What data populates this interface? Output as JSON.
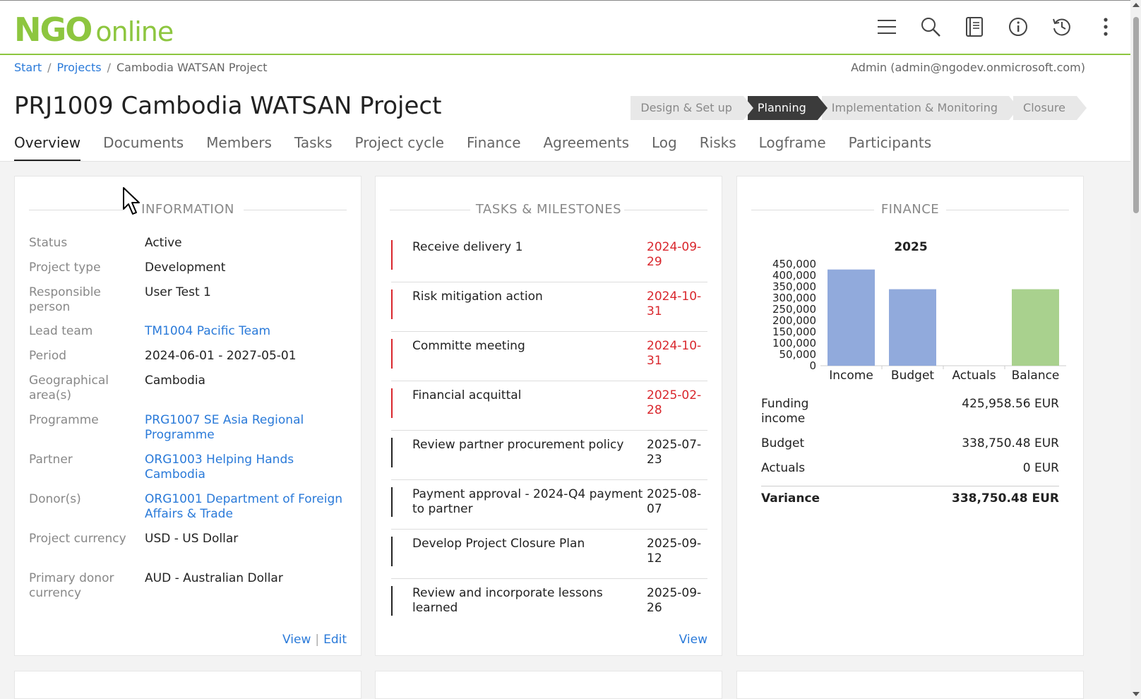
{
  "header": {
    "logo_ngo": "NGO",
    "logo_online": "online",
    "icons": [
      "menu-icon",
      "search-icon",
      "book-icon",
      "info-icon",
      "history-icon",
      "more-vertical-icon"
    ]
  },
  "breadcrumb": {
    "start": "Start",
    "sep1": "/",
    "projects": "Projects",
    "sep2": "/",
    "current": "Cambodia WATSAN Project"
  },
  "user": "Admin (admin@ngodev.onmicrosoft.com)",
  "page_title": "PRJ1009 Cambodia WATSAN Project",
  "stages": [
    {
      "label": "Design & Set up",
      "active": false
    },
    {
      "label": "Planning",
      "active": true
    },
    {
      "label": "Implementation & Monitoring",
      "active": false
    },
    {
      "label": "Closure",
      "active": false
    }
  ],
  "tabs": [
    "Overview",
    "Documents",
    "Members",
    "Tasks",
    "Project cycle",
    "Finance",
    "Agreements",
    "Log",
    "Risks",
    "Logframe",
    "Participants"
  ],
  "active_tab": "Overview",
  "information": {
    "title": "INFORMATION",
    "rows": [
      {
        "label": "Status",
        "value": "Active",
        "link": false
      },
      {
        "label": "Project type",
        "value": "Development",
        "link": false
      },
      {
        "label": "Responsible person",
        "value": "User Test 1",
        "link": false
      },
      {
        "label": "Lead team",
        "value": "TM1004 Pacific Team",
        "link": true
      },
      {
        "label": "Period",
        "value": "2024-06-01 - 2027-05-01",
        "link": false
      },
      {
        "label": "Geographical area(s)",
        "value": "Cambodia",
        "link": false
      },
      {
        "label": "Programme",
        "value": "PRG1007 SE Asia Regional Programme",
        "link": true
      },
      {
        "label": "Partner",
        "value": "ORG1003 Helping Hands Cambodia",
        "link": true
      },
      {
        "label": "Donor(s)",
        "value": "ORG1001 Department of Foreign Affairs & Trade",
        "link": true
      },
      {
        "label": "Project currency",
        "value": "USD - US Dollar",
        "link": false
      },
      {
        "label": "Primary donor currency",
        "value": "AUD - Australian Dollar",
        "link": false
      }
    ],
    "view": "View",
    "pipe": "|",
    "edit": "Edit"
  },
  "tasks": {
    "title": "TASKS & MILESTONES",
    "items": [
      {
        "name": "Receive delivery 1",
        "date1": "2024-09-",
        "date2": "29",
        "overdue": true
      },
      {
        "name": "Risk mitigation action",
        "date1": "2024-10-",
        "date2": "31",
        "overdue": true
      },
      {
        "name": "Committe meeting",
        "date1": "2024-10-",
        "date2": "31",
        "overdue": true
      },
      {
        "name": "Financial acquittal",
        "date1": "2025-02-",
        "date2": "28",
        "overdue": true
      },
      {
        "name": "Review partner procurement policy",
        "date1": "2025-07-",
        "date2": "23",
        "overdue": false
      },
      {
        "name": "Payment approval - 2024-Q4 payment to partner",
        "date1": "2025-08-",
        "date2": "07",
        "overdue": false
      },
      {
        "name": "Develop Project Closure Plan",
        "date1": "2025-09-",
        "date2": "12",
        "overdue": false
      },
      {
        "name": "Review and incorporate lessons learned",
        "date1": "2025-09-",
        "date2": "26",
        "overdue": false
      }
    ],
    "view": "View"
  },
  "finance": {
    "title": "FINANCE",
    "rows": [
      {
        "label": "Funding income",
        "value": "425,958.56 EUR"
      },
      {
        "label": "Budget",
        "value": "338,750.48 EUR"
      },
      {
        "label": "Actuals",
        "value": "0 EUR"
      }
    ],
    "total": {
      "label": "Variance",
      "value": "338,750.48 EUR"
    }
  },
  "colors": {
    "brand_green": "#8dc63f",
    "link_blue": "#2a7ad9",
    "overdue_red": "#d9262c",
    "bar_blue": "#91aadc",
    "bar_green": "#a9d18e"
  },
  "chart_data": {
    "type": "bar",
    "title": "2025",
    "categories": [
      "Income",
      "Budget",
      "Actuals",
      "Balance"
    ],
    "values": [
      425958.56,
      338750.48,
      0,
      338750.48
    ],
    "bar_colors": [
      "#91aadc",
      "#91aadc",
      "#91aadc",
      "#a9d18e"
    ],
    "ylim": [
      0,
      450000
    ],
    "yticks": [
      "450,000",
      "400,000",
      "350,000",
      "300,000",
      "250,000",
      "200,000",
      "150,000",
      "100,000",
      "50,000",
      "0"
    ],
    "ytick_values": [
      450000,
      400000,
      350000,
      300000,
      250000,
      200000,
      150000,
      100000,
      50000,
      0
    ],
    "xlabel": "",
    "ylabel": ""
  }
}
